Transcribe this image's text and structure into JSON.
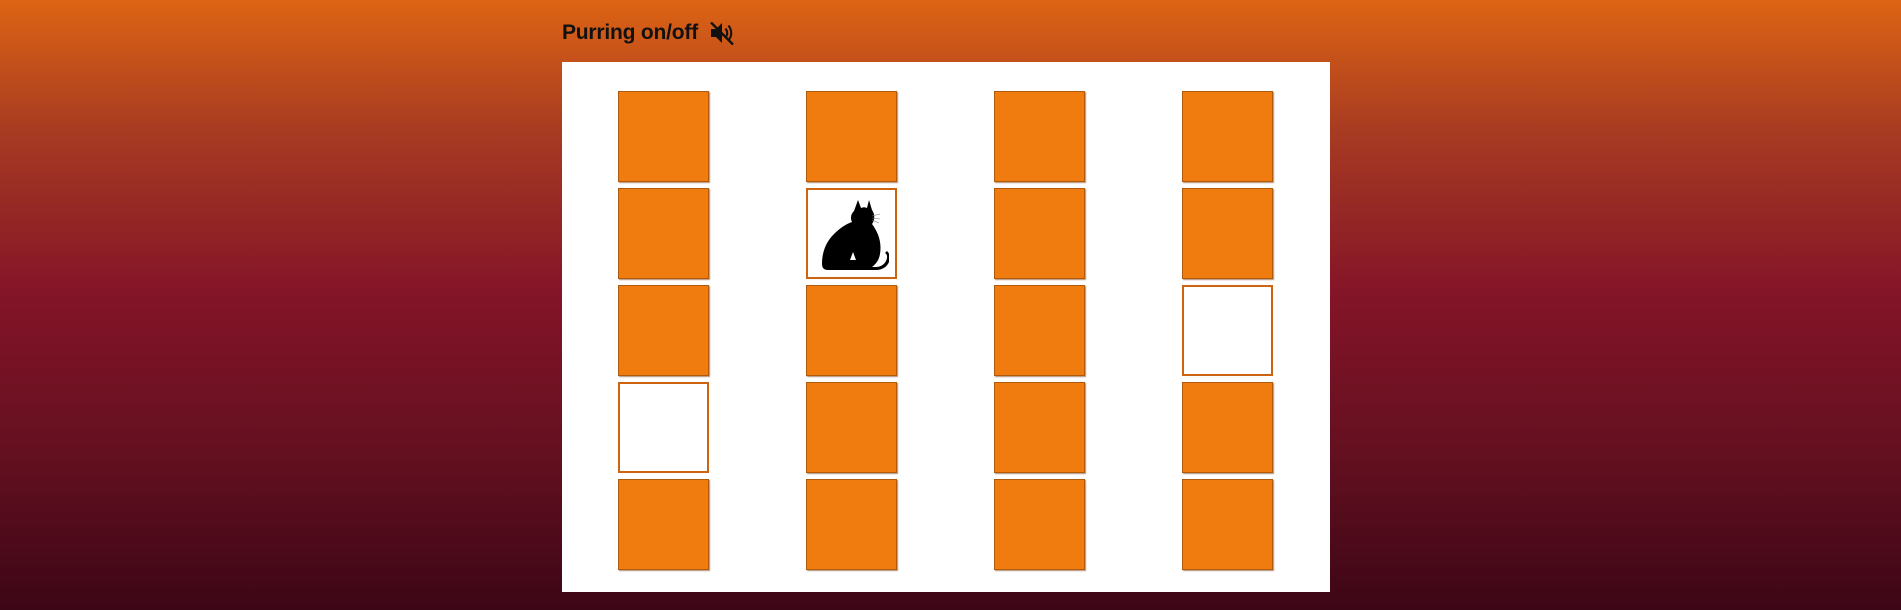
{
  "header": {
    "purring_label": "Purring on/off",
    "sound_icon": "speaker-muted-icon"
  },
  "colors": {
    "tile_hidden": "#f07c10",
    "tile_border": "#b25a0c",
    "tile_revealed": "#ffffff",
    "board": "#ffffff",
    "background_top": "#dd6414",
    "background_bottom": "#3c0616"
  },
  "board": {
    "columns": 4,
    "rows": 5,
    "tiles": [
      [
        "hidden",
        "hidden",
        "hidden",
        "hidden"
      ],
      [
        "hidden",
        "cat",
        "hidden",
        "hidden"
      ],
      [
        "hidden",
        "hidden",
        "hidden",
        "empty"
      ],
      [
        "empty",
        "hidden",
        "hidden",
        "hidden"
      ],
      [
        "hidden",
        "hidden",
        "hidden",
        "hidden"
      ]
    ],
    "revealed_icon": "cat-silhouette-icon"
  }
}
